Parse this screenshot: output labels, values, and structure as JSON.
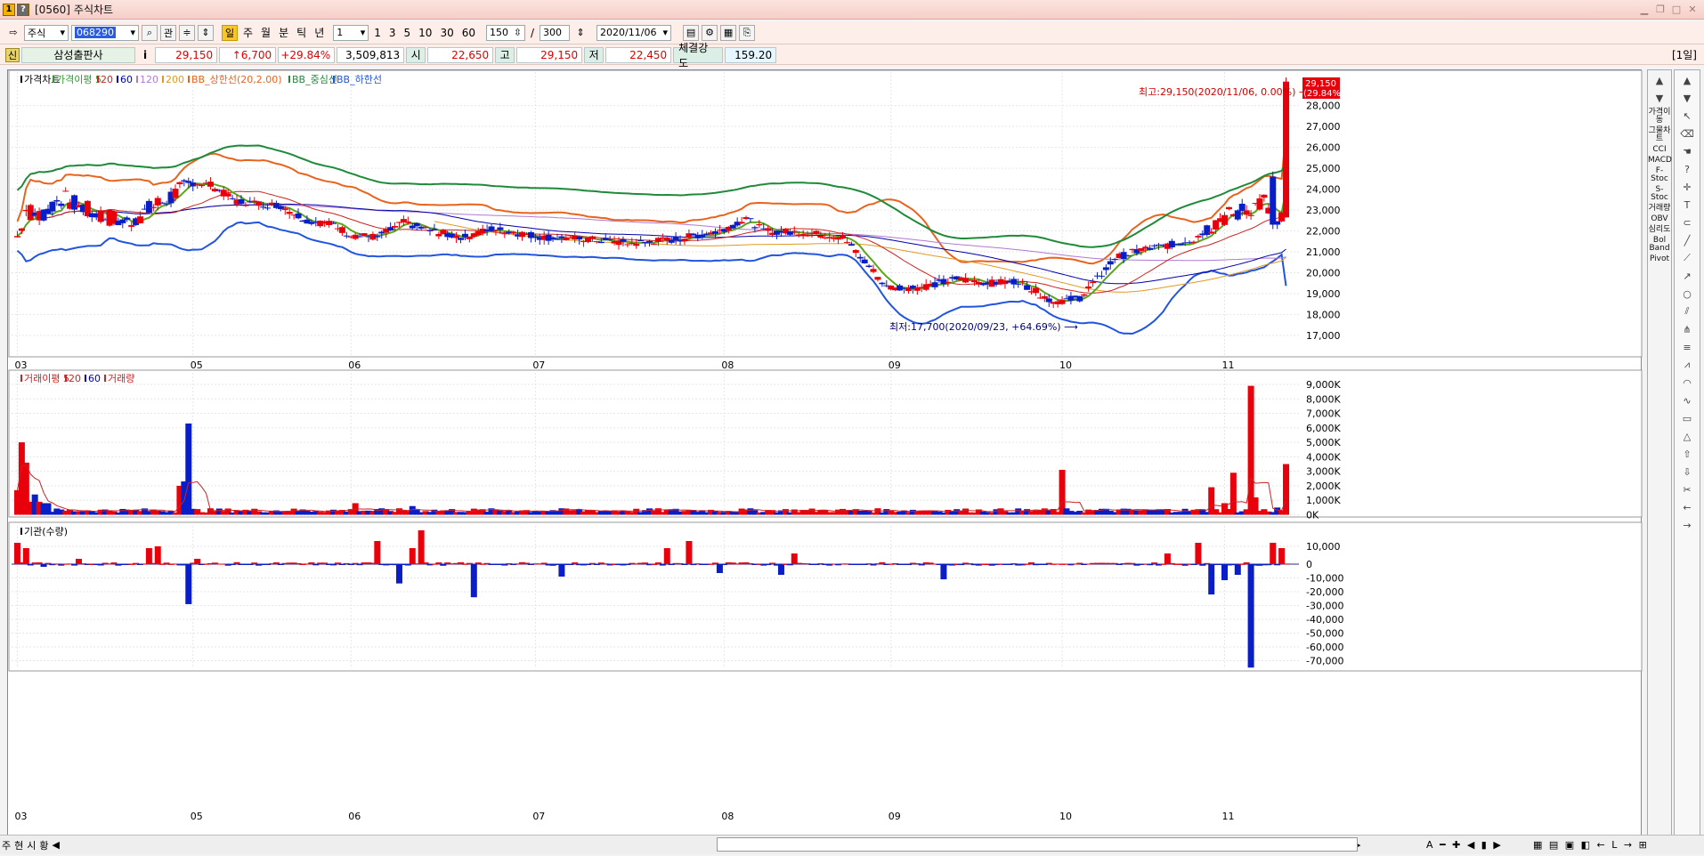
{
  "window": {
    "code": "[0560]",
    "title": "주식차트",
    "icon_a": "1",
    "icon_b": "?"
  },
  "toolbar": {
    "market": "주식",
    "code": "068290",
    "search_icon": "search-icon",
    "btn_kwan": "관",
    "badge": "일",
    "periods": [
      "주",
      "월",
      "분",
      "틱",
      "년"
    ],
    "interval_value": "1",
    "intervals": [
      "1",
      "3",
      "5",
      "10",
      "30",
      "60"
    ],
    "count": "150",
    "total": "300",
    "date": "2020/11/06"
  },
  "quote": {
    "badge": "신",
    "name": "삼성출판사",
    "info": "i",
    "price": "29,150",
    "change": "↑6,700",
    "rate": "+29.84%",
    "volume": "3,509,813",
    "open_label": "시",
    "open": "22,650",
    "high_label": "고",
    "high": "29,150",
    "low_label": "저",
    "low": "22,450",
    "strength_label": "체결강도",
    "strength": "159.20"
  },
  "period_label": "[1일]",
  "price_legend": [
    {
      "text": "가격차트",
      "color": "#000000"
    },
    {
      "text": "가격이평 5",
      "color": "#2e9a2e"
    },
    {
      "text": "20",
      "color": "#cc2222"
    },
    {
      "text": "60",
      "color": "#0000aa"
    },
    {
      "text": "120",
      "color": "#b07ad0"
    },
    {
      "text": "200",
      "color": "#e09a20"
    },
    {
      "text": "BB_상한선(20,2.00)",
      "color": "#e8641e"
    },
    {
      "text": "BB_중심선",
      "color": "#1f8a3a"
    },
    {
      "text": "BB_하한선",
      "color": "#2255dd"
    }
  ],
  "volume_legend": [
    {
      "text": "거래이평 5",
      "color": "#cc2222"
    },
    {
      "text": "20",
      "color": "#cc2222"
    },
    {
      "text": "60",
      "color": "#0000aa"
    },
    {
      "text": "거래량",
      "color": "#cc2222"
    }
  ],
  "inst_legend": [
    {
      "text": "기관(수량)",
      "color": "#000000"
    }
  ],
  "annotations": {
    "high": "최고:29,150(2020/11/06, 0.00%)",
    "low": "최저:17,700(2020/09/23, +64.69%)",
    "last_price": "29,150",
    "last_rate": "(29.84%)"
  },
  "months": [
    {
      "label": "03",
      "idx": 0
    },
    {
      "label": "05",
      "idx": 40
    },
    {
      "label": "06",
      "idx": 76
    },
    {
      "label": "07",
      "idx": 118
    },
    {
      "label": "08",
      "idx": 161
    },
    {
      "label": "09",
      "idx": 199
    },
    {
      "label": "10",
      "idx": 238
    },
    {
      "label": "11",
      "idx": 275
    }
  ],
  "price_ticks": [
    "28,000",
    "27,000",
    "26,000",
    "25,000",
    "24,000",
    "23,000",
    "22,000",
    "21,000",
    "20,000",
    "19,000",
    "18,000",
    "17,000"
  ],
  "volume_ticks": [
    "9,000K",
    "8,000K",
    "7,000K",
    "6,000K",
    "5,000K",
    "4,000K",
    "3,000K",
    "2,000K",
    "1,000K",
    "0K"
  ],
  "inst_ticks": [
    "10,000",
    "0",
    "-10,000",
    "-20,000",
    "-30,000",
    "-40,000",
    "-50,000",
    "-60,000",
    "-70,000"
  ],
  "colors": {
    "up": "#e8000b",
    "down": "#0a1ec8",
    "bb_upper": "#e8641e",
    "bb_mid": "#1f8a3a",
    "bb_lower": "#2255dd",
    "ma5": "#5aa51e",
    "ma20": "#cc2222",
    "ma60": "#0000aa",
    "ma120": "#b07ad0",
    "ma200": "#e09a20"
  },
  "right_indicators": [
    "가격이동",
    "그물차트",
    "CCI",
    "MACD",
    "F-Stoc",
    "S-Stoc",
    "거래량",
    "OBV",
    "심리도",
    "Bol Band",
    "Pivot"
  ],
  "status_tabs": [
    "주",
    "현",
    "시",
    "황"
  ]
}
